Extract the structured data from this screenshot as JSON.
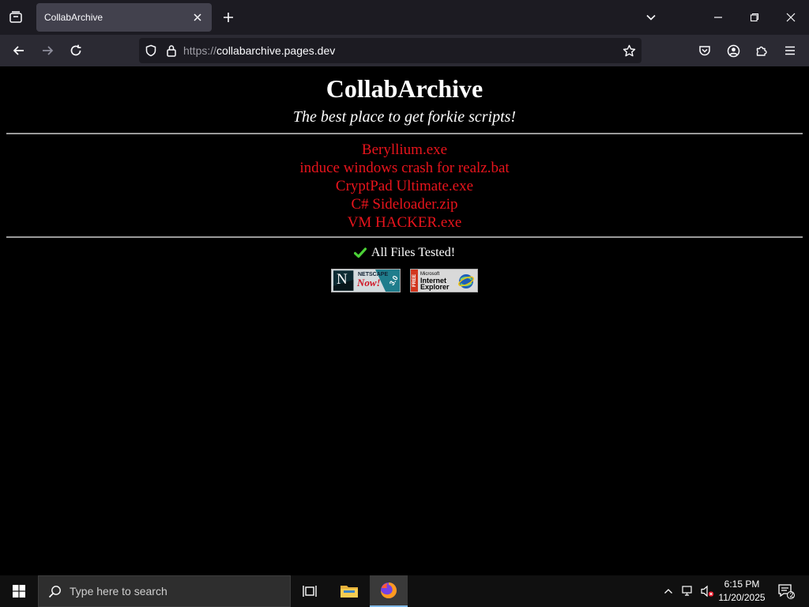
{
  "browser": {
    "tab_title": "CollabArchive",
    "url_scheme": "https://",
    "url_host": "collabarchive.pages.dev"
  },
  "page": {
    "title": "CollabArchive",
    "tagline": "The best place to get forkie scripts!",
    "files": [
      "Beryllium.exe",
      "induce windows crash for realz.bat",
      "CryptPad Ultimate.exe",
      "C# Sideloader.zip",
      "VM HACKER.exe"
    ],
    "tested_text": "All Files Tested!",
    "badges": {
      "netscape": {
        "line1": "NETSCAPE",
        "line2": "Now!",
        "version": "3.0"
      },
      "ie": {
        "free": "FREE",
        "line1": "Microsoft",
        "line2": "Internet",
        "line3": "Explorer"
      }
    },
    "link_color": "#e8141c"
  },
  "taskbar": {
    "search_placeholder": "Type here to search",
    "time": "6:15 PM",
    "date": "11/20/2025",
    "notification_count": "2"
  }
}
